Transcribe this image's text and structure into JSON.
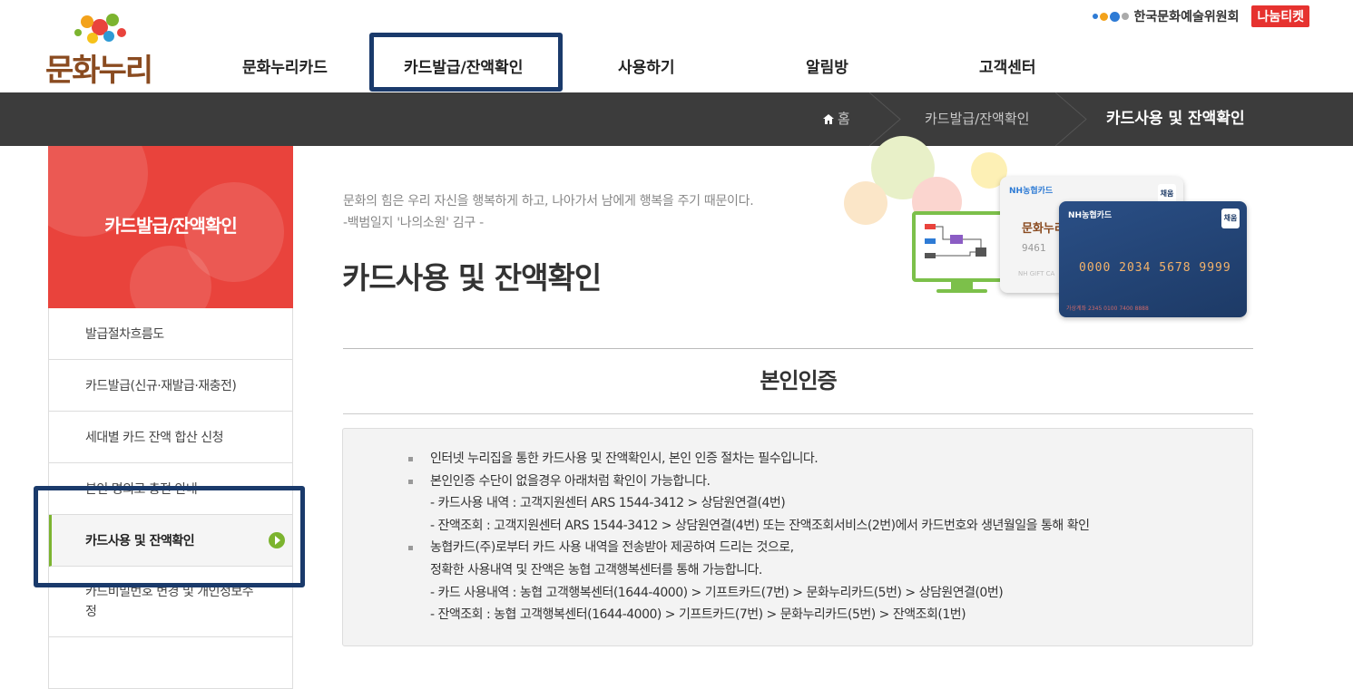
{
  "header": {
    "logo_text": "문화누리",
    "arko_label": "한국문화예술위원회",
    "nanum_label": "나눔티켓",
    "gnb": [
      "문화누리카드",
      "카드발급/잔액확인",
      "사용하기",
      "알림방",
      "고객센터"
    ]
  },
  "breadcrumb": {
    "home": "홈",
    "level1": "카드발급/잔액확인",
    "current": "카드사용 및 잔액확인"
  },
  "sidebar": {
    "title": "카드발급/잔액확인",
    "items": [
      "발급절차흐름도",
      "카드발급(신규·재발급·재충전)",
      "세대별 카드 잔액 합산 신청",
      "본인 명의로 충전 안내",
      "카드사용 및 잔액확인",
      "카드비밀번호 변경 및 개인정보수정"
    ]
  },
  "content": {
    "quote_line1": "문화의 힘은 우리 자신을 행복하게 하고, 나아가서 남에게 행복을 주기 때문이다.",
    "quote_line2": "-백범일지 '나의소원' 김구 -",
    "page_title": "카드사용 및 잔액확인",
    "section_title": "본인인증",
    "info": [
      "인터넷 누리집을 통한 카드사용 및 잔액확인시, 본인 인증 절차는 필수입니다.",
      "본인인증 수단이 없을경우 아래처럼 확인이 가능합니다.",
      "- 카드사용 내역 : 고객지원센터 ARS 1544-3412 > 상담원연결(4번)",
      "- 잔액조회 : 고객지원센터 ARS 1544-3412 > 상담원연결(4번) 또는 잔액조회서비스(2번)에서 카드번호와 생년월일을 통해 확인",
      "농협카드(주)로부터 카드 사용 내역을 전송받아 제공하여 드리는 것으로,",
      "정확한 사용내역 및 잔액은 농협 고객행복센터를 통해 가능합니다.",
      "- 카드 사용내역 : 농협 고객행복센터(1644-4000) > 기프트카드(7번) > 문화누리카드(5번) > 상담원연결(0번)",
      "- 잔액조회 : 농협 고객행복센터(1644-4000) > 기프트카드(7번) > 문화누리카드(5번) > 잔액조회(1번)"
    ]
  },
  "visual": {
    "card_brand": "NH농협카드",
    "card_badge": "채움",
    "card_number": "0000 2034 5678 9999",
    "card_account": "가상계좌 2345 0100 7400 8888",
    "card_logo": "문화누리",
    "card_partial_number": "9461",
    "card_gift": "NH GIFT CA"
  },
  "colors": {
    "brand_red": "#e9433c",
    "dark_bar": "#3c3c3c",
    "highlight_box": "#1a3a6b",
    "active_green": "#7cb42f"
  }
}
